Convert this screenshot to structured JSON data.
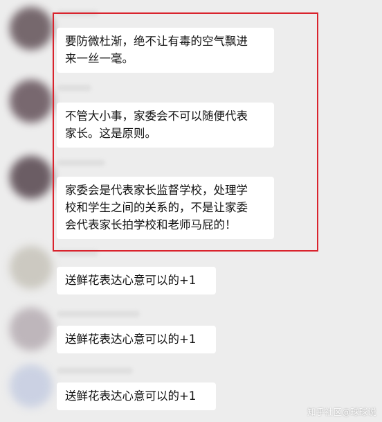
{
  "messages": [
    {
      "text": "要防微杜渐，绝不让有毒的空气飘进\n来一丝一毫。"
    },
    {
      "text": "不管大小事，家委会不可以随便代表\n家长。这是原则。"
    },
    {
      "text": "家委会是代表家长监督学校，处理学\n校和学生之间的关系的，不是让家委\n会代表家长拍学校和老师马屁的！"
    },
    {
      "text": "送鲜花表达心意可以的+1"
    },
    {
      "text": "送鲜花表达心意可以的+1"
    },
    {
      "text": "送鲜花表达心意可以的+1"
    }
  ],
  "watermark": "知乎社区@球球说",
  "colors": {
    "background": "#ededed",
    "bubble": "#ffffff",
    "highlight_border": "#d9232d"
  }
}
